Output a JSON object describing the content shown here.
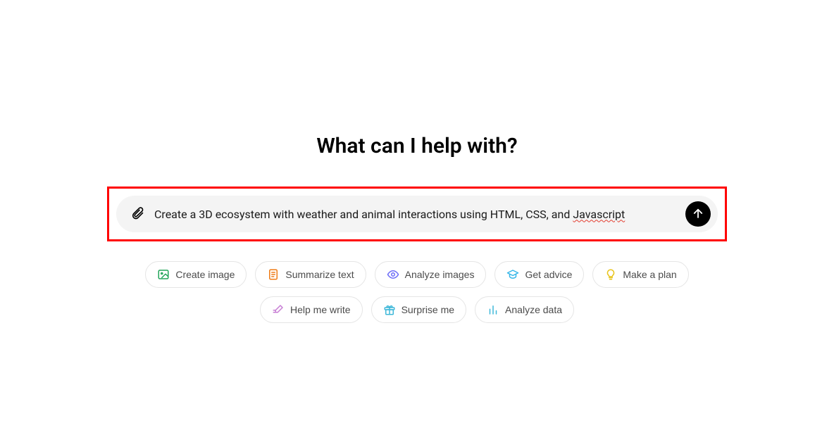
{
  "heading": "What can I help with?",
  "input": {
    "value": "Create a 3D ecosystem with weather and animal interactions using HTML, CSS, and ",
    "misspelled_tail": "Javascript"
  },
  "chips": [
    {
      "key": "create-image",
      "label": "Create image",
      "icon": "image-icon",
      "color": "#22a559"
    },
    {
      "key": "summarize-text",
      "label": "Summarize text",
      "icon": "document-icon",
      "color": "#ef7b16"
    },
    {
      "key": "analyze-images",
      "label": "Analyze images",
      "icon": "eye-icon",
      "color": "#6d6df7"
    },
    {
      "key": "get-advice",
      "label": "Get advice",
      "icon": "graduation-icon",
      "color": "#36b6e8"
    },
    {
      "key": "make-a-plan",
      "label": "Make a plan",
      "icon": "lightbulb-icon",
      "color": "#e8c41a"
    },
    {
      "key": "help-me-write",
      "label": "Help me write",
      "icon": "pencil-icon",
      "color": "#c77dd4"
    },
    {
      "key": "surprise-me",
      "label": "Surprise me",
      "icon": "gift-icon",
      "color": "#3fb8d9"
    },
    {
      "key": "analyze-data",
      "label": "Analyze data",
      "icon": "chart-icon",
      "color": "#3fb8d9"
    }
  ]
}
